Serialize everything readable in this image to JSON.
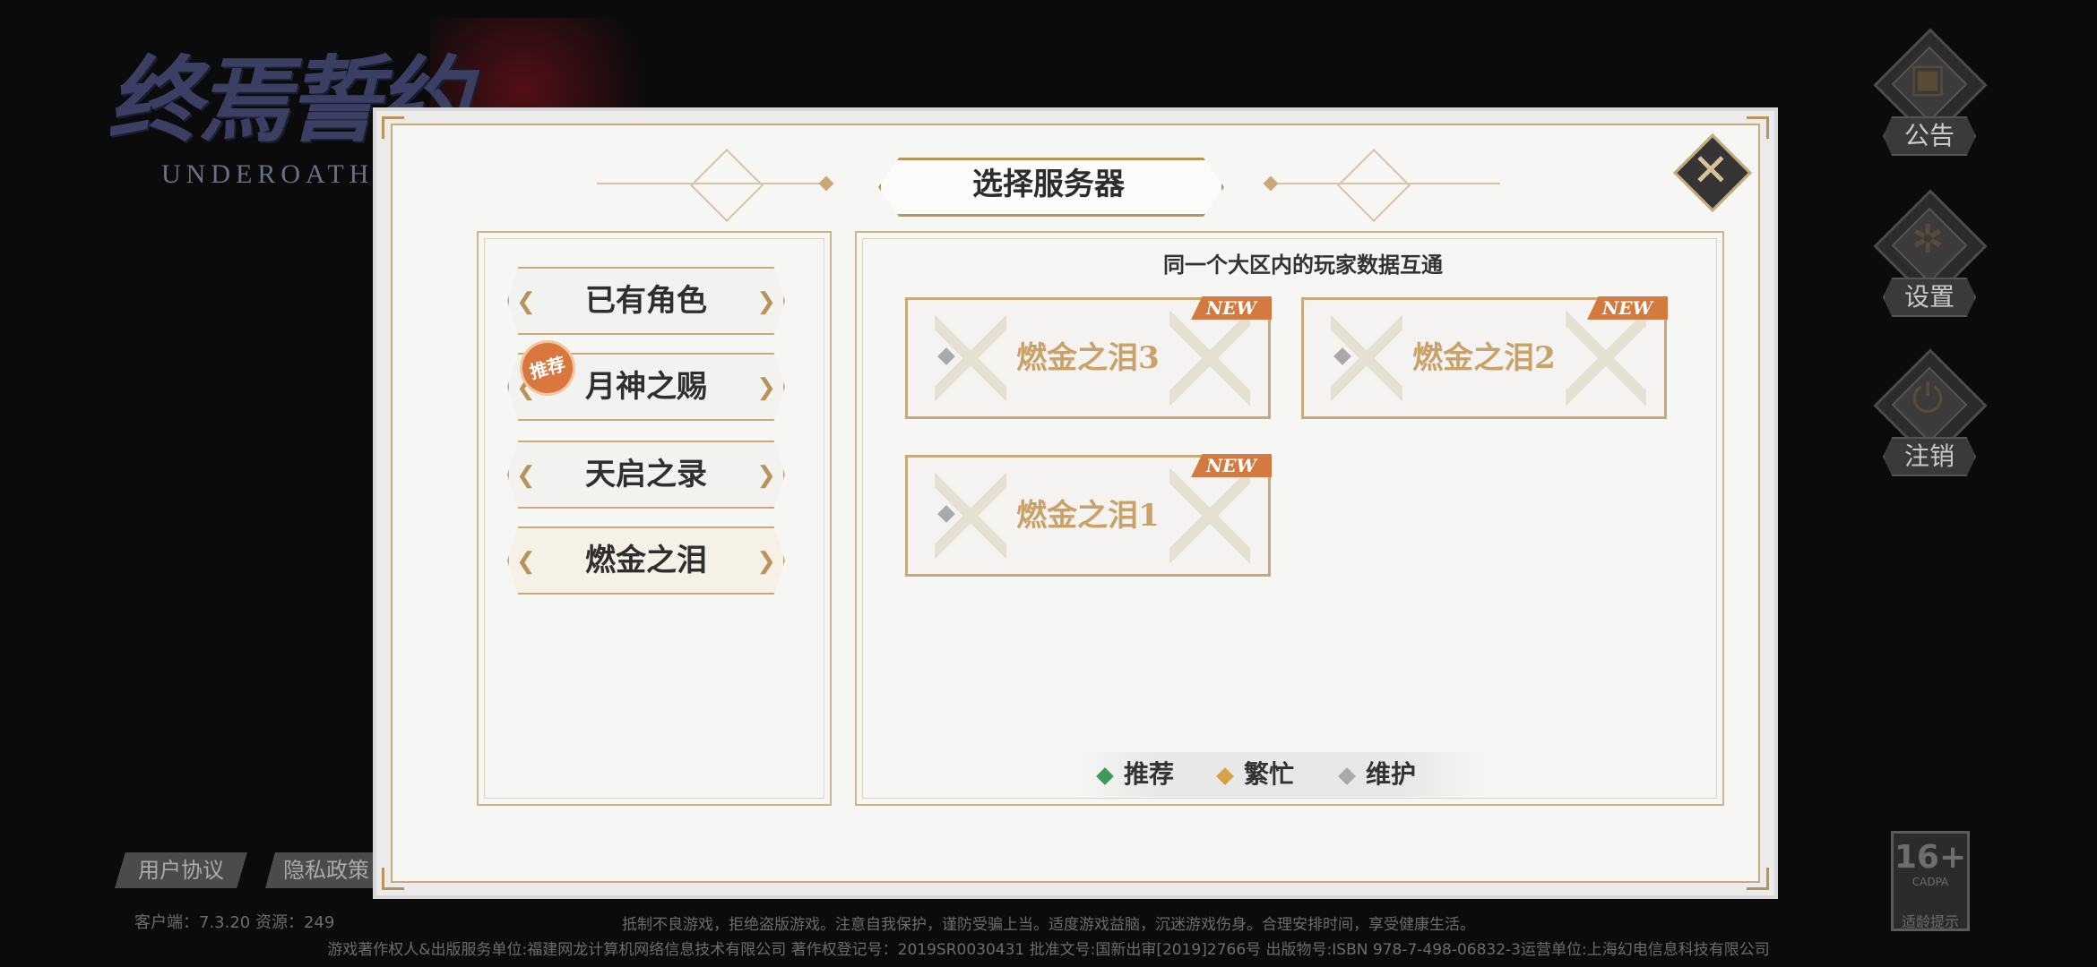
{
  "logo": {
    "title": "终焉誓约",
    "subtitle": "UNDEROATH"
  },
  "side_buttons": [
    {
      "label": "公告",
      "icon": "notice-icon"
    },
    {
      "label": "设置",
      "icon": "settings-icon"
    },
    {
      "label": "注销",
      "icon": "logout-icon"
    }
  ],
  "dialog": {
    "title": "选择服务器",
    "hint": "同一个大区内的玩家数据互通",
    "tabs": [
      {
        "label": "已有角色"
      },
      {
        "label": "月神之赐",
        "badge": "推荐"
      },
      {
        "label": "天启之录"
      },
      {
        "label": "燃金之泪"
      }
    ],
    "active_tab": "燃金之泪",
    "servers": [
      {
        "name": "燃金之泪3",
        "tag": "NEW"
      },
      {
        "name": "燃金之泪2",
        "tag": "NEW"
      },
      {
        "name": "燃金之泪1",
        "tag": "NEW"
      }
    ],
    "legend": [
      {
        "label": "推荐",
        "color": "#3f9a5a"
      },
      {
        "label": "繁忙",
        "color": "#d9a04a"
      },
      {
        "label": "维护",
        "color": "#a9a9a9"
      }
    ]
  },
  "links": {
    "user_agreement": "用户协议",
    "privacy_policy": "隐私政策"
  },
  "version": "客户端：7.3.20  资源：249",
  "footer": {
    "line1": "抵制不良游戏，拒绝盗版游戏。注意自我保护，谨防受骗上当。适度游戏益脑，沉迷游戏伤身。合理安排时间，享受健康生活。",
    "line2": "游戏著作权人&出版服务单位:福建网龙计算机网络信息技术有限公司  著作权登记号：2019SR0030431  批准文号:国新出审[2019]2766号  出版物号:ISBN 978-7-498-06832-3运营单位:上海幻电信息科技有限公司"
  },
  "age_rating": {
    "value": "16+",
    "org": "CADPA",
    "tip": "适龄提示"
  }
}
